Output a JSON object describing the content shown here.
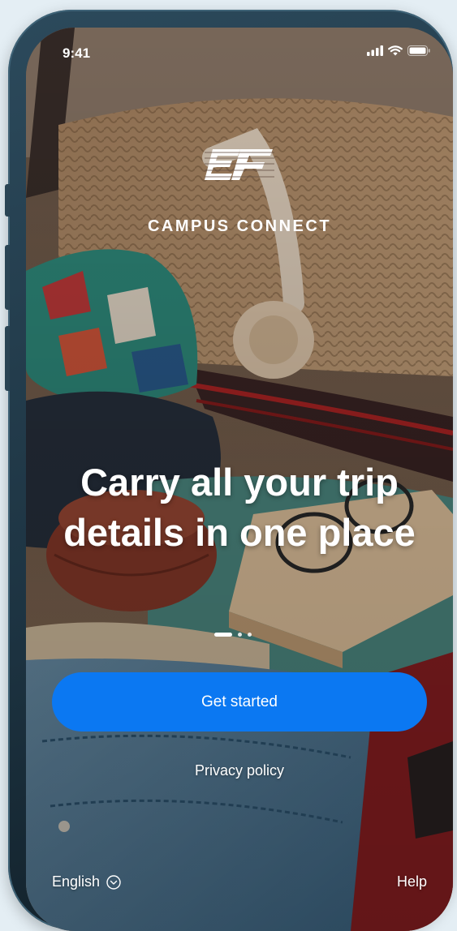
{
  "status_bar": {
    "time": "9:41"
  },
  "brand": {
    "name": "CAMPUS CONNECT",
    "logo_icon": "ef-logo-icon"
  },
  "onboarding": {
    "headline": "Carry all your trip details in one place",
    "page_count": 3,
    "active_page": 1
  },
  "actions": {
    "get_started_label": "Get started",
    "privacy_label": "Privacy policy"
  },
  "footer": {
    "language_label": "English",
    "language_icon": "chevron-down-circle-icon",
    "help_label": "Help"
  },
  "colors": {
    "primary_button": "#0b78f2",
    "text": "#ffffff"
  }
}
